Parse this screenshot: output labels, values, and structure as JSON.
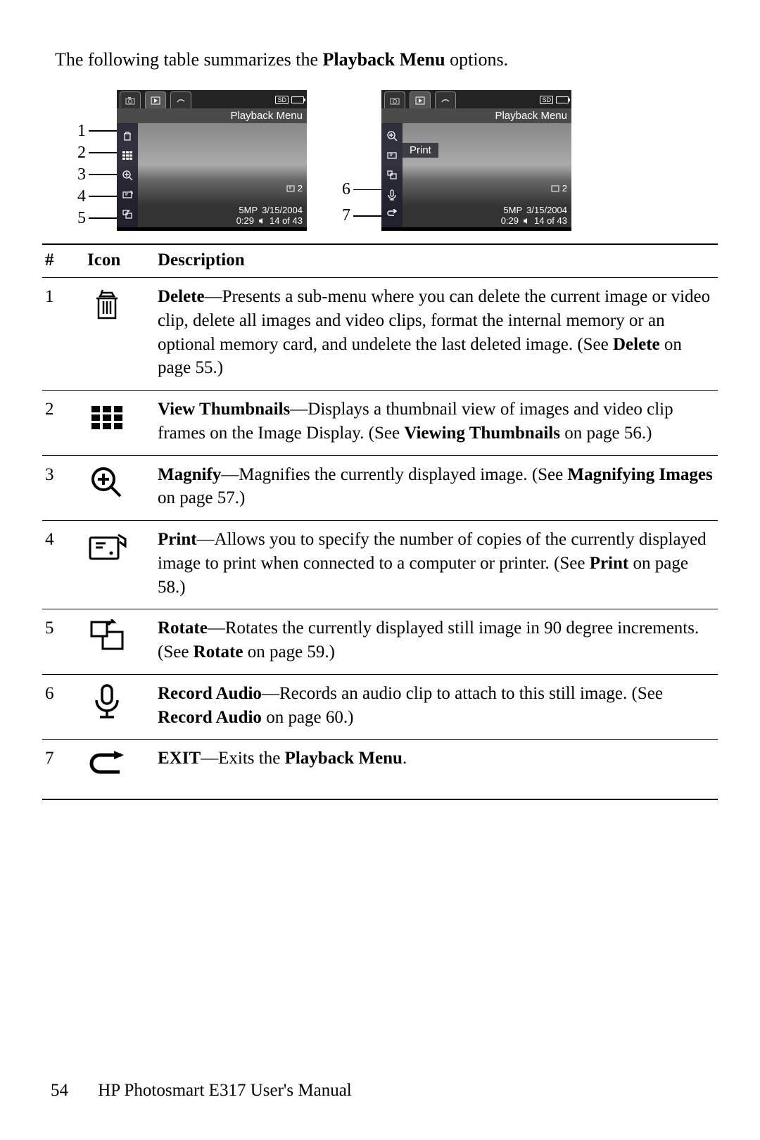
{
  "intro": {
    "prefix": "The following table summarizes the ",
    "bold": "Playback Menu",
    "suffix": " options."
  },
  "screen": {
    "title": "Playback Menu",
    "print_label": "Print",
    "print_count": "2",
    "resolution": "5MP",
    "date": "3/15/2004",
    "time": "0:29",
    "counter": "14 of 43",
    "sd": "SD"
  },
  "callouts_left": [
    "1",
    "2",
    "3",
    "4",
    "5"
  ],
  "callouts_right": [
    "6",
    "7"
  ],
  "table": {
    "headers": {
      "num": "#",
      "icon": "Icon",
      "desc": "Description"
    },
    "rows": [
      {
        "num": "1",
        "title": "Delete",
        "body": "—Presents a sub-menu where you can delete the current image or video clip, delete all images and video clips, format the internal memory or an optional memory card, and undelete the last deleted image. (See ",
        "ref": "Delete",
        "after": " on page 55.)"
      },
      {
        "num": "2",
        "title": "View Thumbnails",
        "body": "—Displays a thumbnail view of images and video clip frames on the Image Display. (See ",
        "ref": "Viewing Thumbnails",
        "after": " on page 56.)"
      },
      {
        "num": "3",
        "title": "Magnify",
        "body": "—Magnifies the currently displayed image. (See ",
        "ref": "Magnifying Images",
        "after": " on page 57.)"
      },
      {
        "num": "4",
        "title": "Print",
        "body": "—Allows you to specify the number of copies of the currently displayed image to print when connected to a computer or printer. (See ",
        "ref": "Print",
        "after": " on page 58.)"
      },
      {
        "num": "5",
        "title": "Rotate",
        "body": "—Rotates the currently displayed still image in 90 degree increments. (See ",
        "ref": "Rotate",
        "after": " on page 59.)"
      },
      {
        "num": "6",
        "title": "Record Audio",
        "body": "—Records an audio clip to attach to this still image. (See ",
        "ref": "Record Audio",
        "after": " on page 60.)"
      },
      {
        "num": "7",
        "title": "EXIT",
        "body": "—Exits the ",
        "ref": "Playback Menu",
        "after": "."
      }
    ]
  },
  "footer": {
    "page": "54",
    "title": "HP Photosmart E317 User's Manual"
  }
}
